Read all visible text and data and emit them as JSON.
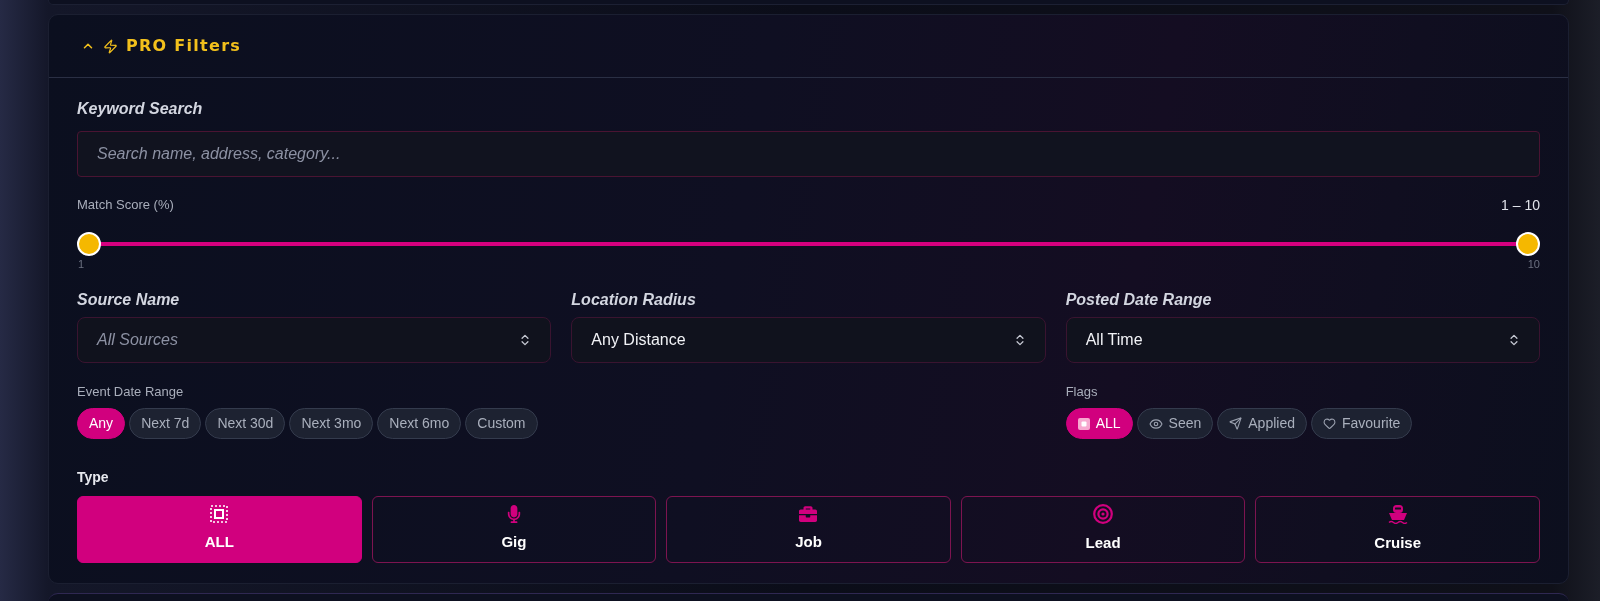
{
  "header": {
    "title": "PRO Filters",
    "expanded": true
  },
  "keyword_search": {
    "label": "Keyword Search",
    "placeholder": "Search name, address, category..."
  },
  "match_score": {
    "label": "Match Score (%)",
    "reading": "1 – 10",
    "thumbs": [
      {
        "level": 0
      },
      {
        "level": 1
      }
    ],
    "min_label": "1",
    "max_label": "10"
  },
  "selects": [
    {
      "label": "Source Name",
      "placeholder": "All Sources"
    },
    {
      "label": "Location Radius",
      "value": "Any Distance"
    },
    {
      "label": "Posted Date Range",
      "value": "All Time"
    }
  ],
  "event_date_range": {
    "label": "Event Date Range",
    "options": [
      {
        "label": "Any",
        "selected": true
      },
      {
        "label": "Next 7d",
        "selected": false
      },
      {
        "label": "Next 30d",
        "selected": false
      },
      {
        "label": "Next 3mo",
        "selected": false
      },
      {
        "label": "Next 6mo",
        "selected": false
      },
      {
        "label": "Custom",
        "selected": false
      }
    ]
  },
  "flags": {
    "label": "Flags",
    "options": [
      {
        "kind": "all",
        "label": "ALL",
        "selected": true
      },
      {
        "kind": "seen",
        "label": "Seen",
        "selected": false
      },
      {
        "kind": "applied",
        "label": "Applied",
        "selected": false
      },
      {
        "kind": "favourite",
        "label": "Favourite",
        "selected": false
      }
    ]
  },
  "type": {
    "label": "Type",
    "options": [
      {
        "kind": "all",
        "label": "ALL",
        "selected": true
      },
      {
        "kind": "gig",
        "label": "Gig",
        "selected": false
      },
      {
        "kind": "job",
        "label": "Job",
        "selected": false
      },
      {
        "kind": "lead",
        "label": "Lead",
        "selected": false
      },
      {
        "kind": "cruise",
        "label": "Cruise",
        "selected": false
      }
    ]
  }
}
